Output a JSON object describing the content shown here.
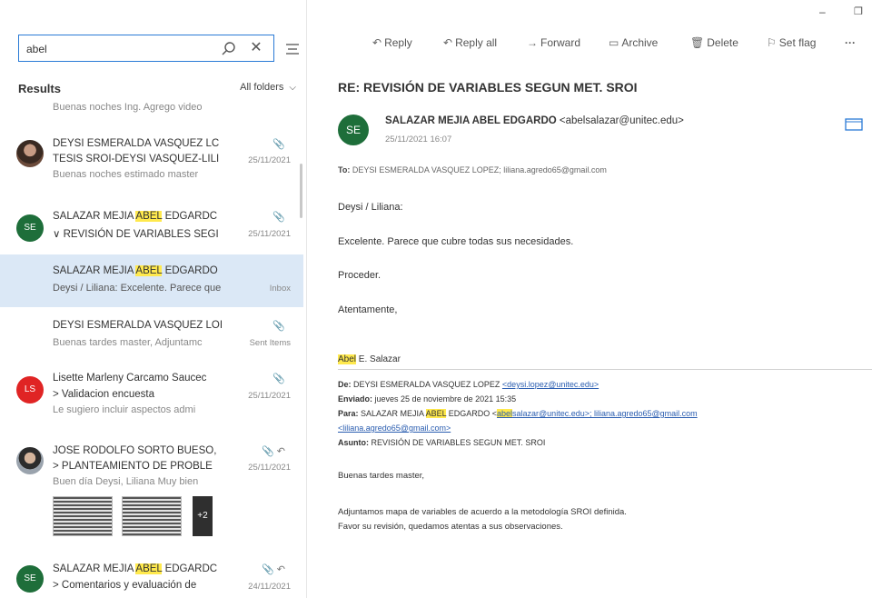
{
  "window": {
    "minimize_glyph": "–",
    "restore_glyph": "❐"
  },
  "search": {
    "value": "abel",
    "clear_glyph": "✕"
  },
  "results": {
    "label": "Results",
    "folder_filter": "All folders",
    "chevron": "⌵"
  },
  "list_top_snippet": "Buenas noches Ing. Agrego video",
  "messages": [
    {
      "avatar_text": "",
      "from": "DEYSI ESMERALDA VASQUEZ LC",
      "subject": "TESIS SROI-DEYSI VASQUEZ-LILI",
      "date": "25/11/2021",
      "preview": "Buenas noches estimado master",
      "attachment": "📎"
    },
    {
      "avatar_text": "SE",
      "from_before": "SALAZAR MEJIA ",
      "from_hl": "ABEL",
      "from_after": " EDGARDC",
      "subject": "∨ REVISIÓN DE VARIABLES SEGI",
      "date": "25/11/2021",
      "attachment": "📎"
    },
    {
      "from_before": "SALAZAR MEJIA ",
      "from_hl": "ABEL",
      "from_after": " EDGARDO",
      "preview": "Deysi / Liliana: Excelente. Parece que",
      "tag": "Inbox"
    },
    {
      "from": "DEYSI ESMERALDA VASQUEZ LOI",
      "preview": "Buenas tardes master, Adjuntamc",
      "tag": "Sent Items",
      "attachment": "📎"
    },
    {
      "avatar_text": "LS",
      "from": "Lisette Marleny Carcamo Saucec",
      "subject": "> Validacion encuesta",
      "date": "25/11/2021",
      "preview": "Le sugiero incluir aspectos admi",
      "attachment": "📎"
    },
    {
      "avatar_text": "",
      "from": "JOSE RODOLFO SORTO BUESO,",
      "subject": "> PLANTEAMIENTO DE PROBLE",
      "date": "25/11/2021",
      "preview": "Buen día Deysi, Liliana Muy bien",
      "attachment": "📎 ↶",
      "more": "+2"
    },
    {
      "avatar_text": "SE",
      "from_before": "SALAZAR MEJIA ",
      "from_hl": "ABEL",
      "from_after": " EDGARDC",
      "subject": "> Comentarios y evaluación de",
      "date": "24/11/2021",
      "attachment": "📎 ↶"
    }
  ],
  "toolbar": {
    "reply": "Reply",
    "reply_all": "Reply all",
    "forward": "Forward",
    "archive": "Archive",
    "delete": "Delete",
    "set_flag": "Set flag",
    "more": "···",
    "reply_glyph": "↶",
    "reply_all_glyph": "↶",
    "forward_glyph": "→",
    "archive_glyph": "▭",
    "delete_glyph": "🗑",
    "flag_glyph": "⚐"
  },
  "email": {
    "subject": "RE: REVISIÓN DE VARIABLES SEGUN MET. SROI",
    "sender_initials": "SE",
    "sender_name": "SALAZAR MEJIA ABEL EDGARDO",
    "sender_email": "<abelsalazar@unitec.edu>",
    "sent_date": "25/11/2021 16:07",
    "to_label": "To:",
    "to_value": "DEYSI ESMERALDA VASQUEZ LOPEZ; liliana.agredo65@gmail.com",
    "body": [
      "Deysi / Liliana:",
      "Excelente. Parece que cubre todas sus necesidades.",
      "Proceder.",
      "Atentamente,"
    ],
    "signature_hl": "Abel",
    "signature_rest": " E. Salazar",
    "quoted": {
      "from_label": "De:",
      "from_value": "DEYSI ESMERALDA VASQUEZ LOPEZ ",
      "from_link": "<deysi.lopez@unitec.edu>",
      "sent_label": "Enviado:",
      "sent_value": "jueves 25 de noviembre de 2021 15:35",
      "to_label": "Para:",
      "to_before": "SALAZAR MEJIA ",
      "to_hl": "ABEL",
      "to_mid": " EDGARDO <",
      "to_link_hl": "abel",
      "to_link_rest": "salazar@unitec.edu>; liliana.agredo65@gmail.com",
      "to_line2": "<liliana.agredo65@gmail.com>",
      "subject_label": "Asunto:",
      "subject_value": "REVISIÓN DE VARIABLES SEGUN MET. SROI",
      "body": [
        "Buenas tardes master,",
        "Adjuntamos mapa de variables de acuerdo a la metodología SROI definida.",
        "Favor su revisión, quedamos atentas a sus observaciones."
      ]
    }
  },
  "colors": {
    "accent": "#2a7ad6",
    "selected": "#dbe8f6",
    "highlight": "#ffe94d",
    "avatar_green": "#1e6e3a",
    "avatar_red": "#e02424"
  }
}
